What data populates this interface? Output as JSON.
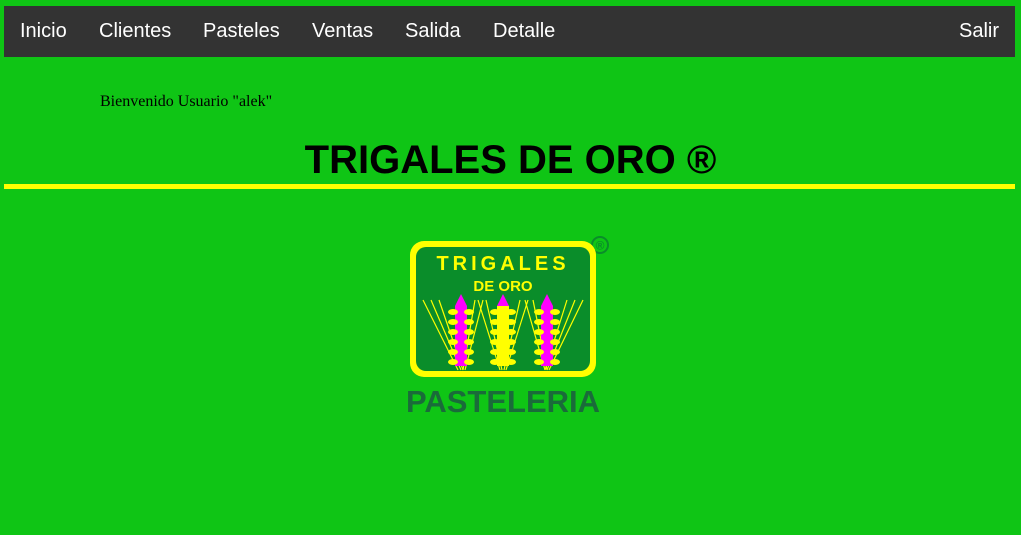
{
  "nav": {
    "items": [
      {
        "label": "Inicio"
      },
      {
        "label": "Clientes"
      },
      {
        "label": "Pasteles"
      },
      {
        "label": "Ventas"
      },
      {
        "label": "Salida"
      },
      {
        "label": "Detalle"
      }
    ],
    "logout_label": "Salir"
  },
  "welcome_text": "Bienvenido Usuario \"alek\"",
  "page_title": "TRIGALES DE ORO ®",
  "logo": {
    "brand_line1": "TRIGALES",
    "brand_line2": "DE ORO",
    "registered_mark": "®",
    "subtitle": "PASTELERIA"
  },
  "colors": {
    "page_background": "#0fc515",
    "nav_background": "#333333",
    "nav_text": "#ffffff",
    "divider": "#ffff00",
    "logo_yellow": "#ffff00",
    "logo_green": "#0a8d2a",
    "logo_magenta": "#ff00ff",
    "logo_text_dark_green": "#1a6b3a"
  }
}
